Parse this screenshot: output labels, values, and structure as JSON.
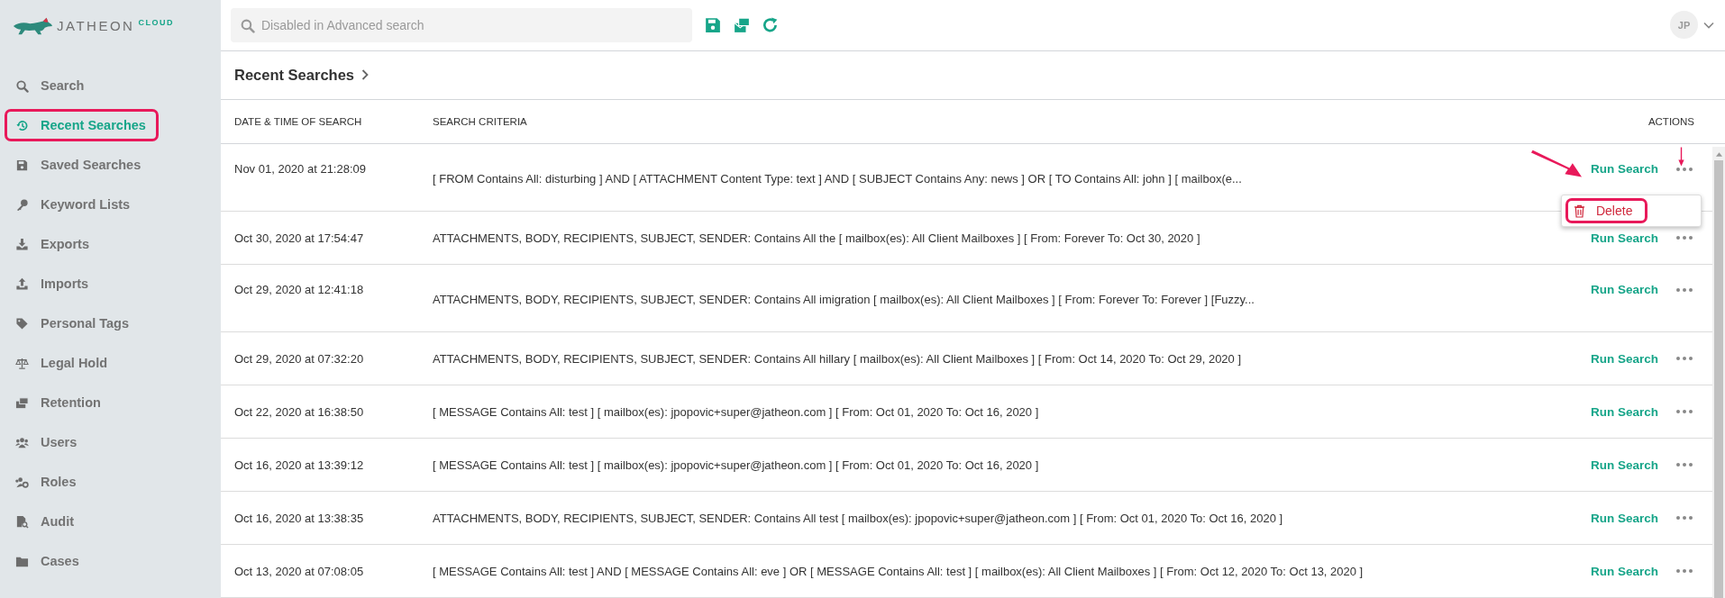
{
  "brand": {
    "name": "JATHEON",
    "suffix": "CLOUD"
  },
  "sidebar": {
    "items": [
      {
        "label": "Search",
        "selected": false,
        "highlighted": false
      },
      {
        "label": "Recent Searches",
        "selected": true,
        "highlighted": true
      },
      {
        "label": "Saved Searches",
        "selected": false,
        "highlighted": false
      },
      {
        "label": "Keyword Lists",
        "selected": false,
        "highlighted": false
      },
      {
        "label": "Exports",
        "selected": false,
        "highlighted": false
      },
      {
        "label": "Imports",
        "selected": false,
        "highlighted": false
      },
      {
        "label": "Personal Tags",
        "selected": false,
        "highlighted": false
      },
      {
        "label": "Legal Hold",
        "selected": false,
        "highlighted": false
      },
      {
        "label": "Retention",
        "selected": false,
        "highlighted": false
      },
      {
        "label": "Users",
        "selected": false,
        "highlighted": false
      },
      {
        "label": "Roles",
        "selected": false,
        "highlighted": false
      },
      {
        "label": "Audit",
        "selected": false,
        "highlighted": false
      },
      {
        "label": "Cases",
        "selected": false,
        "highlighted": false
      }
    ]
  },
  "search": {
    "placeholder": "Disabled in Advanced search"
  },
  "user": {
    "initials": "JP"
  },
  "page": {
    "title": "Recent Searches"
  },
  "table": {
    "columns": [
      "DATE & TIME OF SEARCH",
      "SEARCH CRITERIA",
      "ACTIONS"
    ],
    "rows": [
      {
        "kind": "tall",
        "date": "Nov 01, 2020 at 21:28:09",
        "criteria": "[ FROM Contains All: disturbing ] AND [ ATTACHMENT Content Type: text ] AND [ SUBJECT Contains Any: news ] OR [ TO Contains All: john ] [ mailbox(e...",
        "action": "Run Search",
        "menu_open": true
      },
      {
        "kind": "plain",
        "date": "Oct 30, 2020 at 17:54:47",
        "criteria": "ATTACHMENTS, BODY, RECIPIENTS, SUBJECT, SENDER: Contains All the [ mailbox(es): All Client Mailboxes ] [ From: Forever To: Oct 30, 2020 ]",
        "action": "Run Search",
        "menu_open": false
      },
      {
        "kind": "tall",
        "date": "Oct 29, 2020 at 12:41:18",
        "criteria": "ATTACHMENTS, BODY, RECIPIENTS, SUBJECT, SENDER: Contains All imigration [ mailbox(es): All Client Mailboxes ] [ From: Forever To: Forever ] [Fuzzy...",
        "action": "Run Search",
        "menu_open": false
      },
      {
        "kind": "plain",
        "date": "Oct 29, 2020 at 07:32:20",
        "criteria": "ATTACHMENTS, BODY, RECIPIENTS, SUBJECT, SENDER: Contains All hillary [ mailbox(es): All Client Mailboxes ] [ From: Oct 14, 2020 To: Oct 29, 2020 ]",
        "action": "Run Search",
        "menu_open": false
      },
      {
        "kind": "plain",
        "date": "Oct 22, 2020 at 16:38:50",
        "criteria": "[ MESSAGE Contains All: test ] [ mailbox(es): jpopovic+super@jatheon.com ] [ From: Oct 01, 2020 To: Oct 16, 2020 ]",
        "action": "Run Search",
        "menu_open": false
      },
      {
        "kind": "plain",
        "date": "Oct 16, 2020 at 13:39:12",
        "criteria": "[ MESSAGE Contains All: test ] [ mailbox(es): jpopovic+super@jatheon.com ] [ From: Oct 01, 2020 To: Oct 16, 2020 ]",
        "action": "Run Search",
        "menu_open": false
      },
      {
        "kind": "plain",
        "date": "Oct 16, 2020 at 13:38:35",
        "criteria": "ATTACHMENTS, BODY, RECIPIENTS, SUBJECT, SENDER: Contains All test [ mailbox(es): jpopovic+super@jatheon.com ] [ From: Oct 01, 2020 To: Oct 16, 2020 ]",
        "action": "Run Search",
        "menu_open": false
      },
      {
        "kind": "plain",
        "date": "Oct 13, 2020 at 07:08:05",
        "criteria": "[ MESSAGE Contains All: test ] AND [ MESSAGE Contains All: eve ] OR [ MESSAGE Contains All: test ] [ mailbox(es): All Client Mailboxes ] [ From: Oct 12, 2020 To: Oct 13, 2020 ]",
        "action": "Run Search",
        "menu_open": false
      }
    ]
  },
  "menu": {
    "items": [
      {
        "label": "Delete",
        "highlighted": true
      }
    ]
  }
}
